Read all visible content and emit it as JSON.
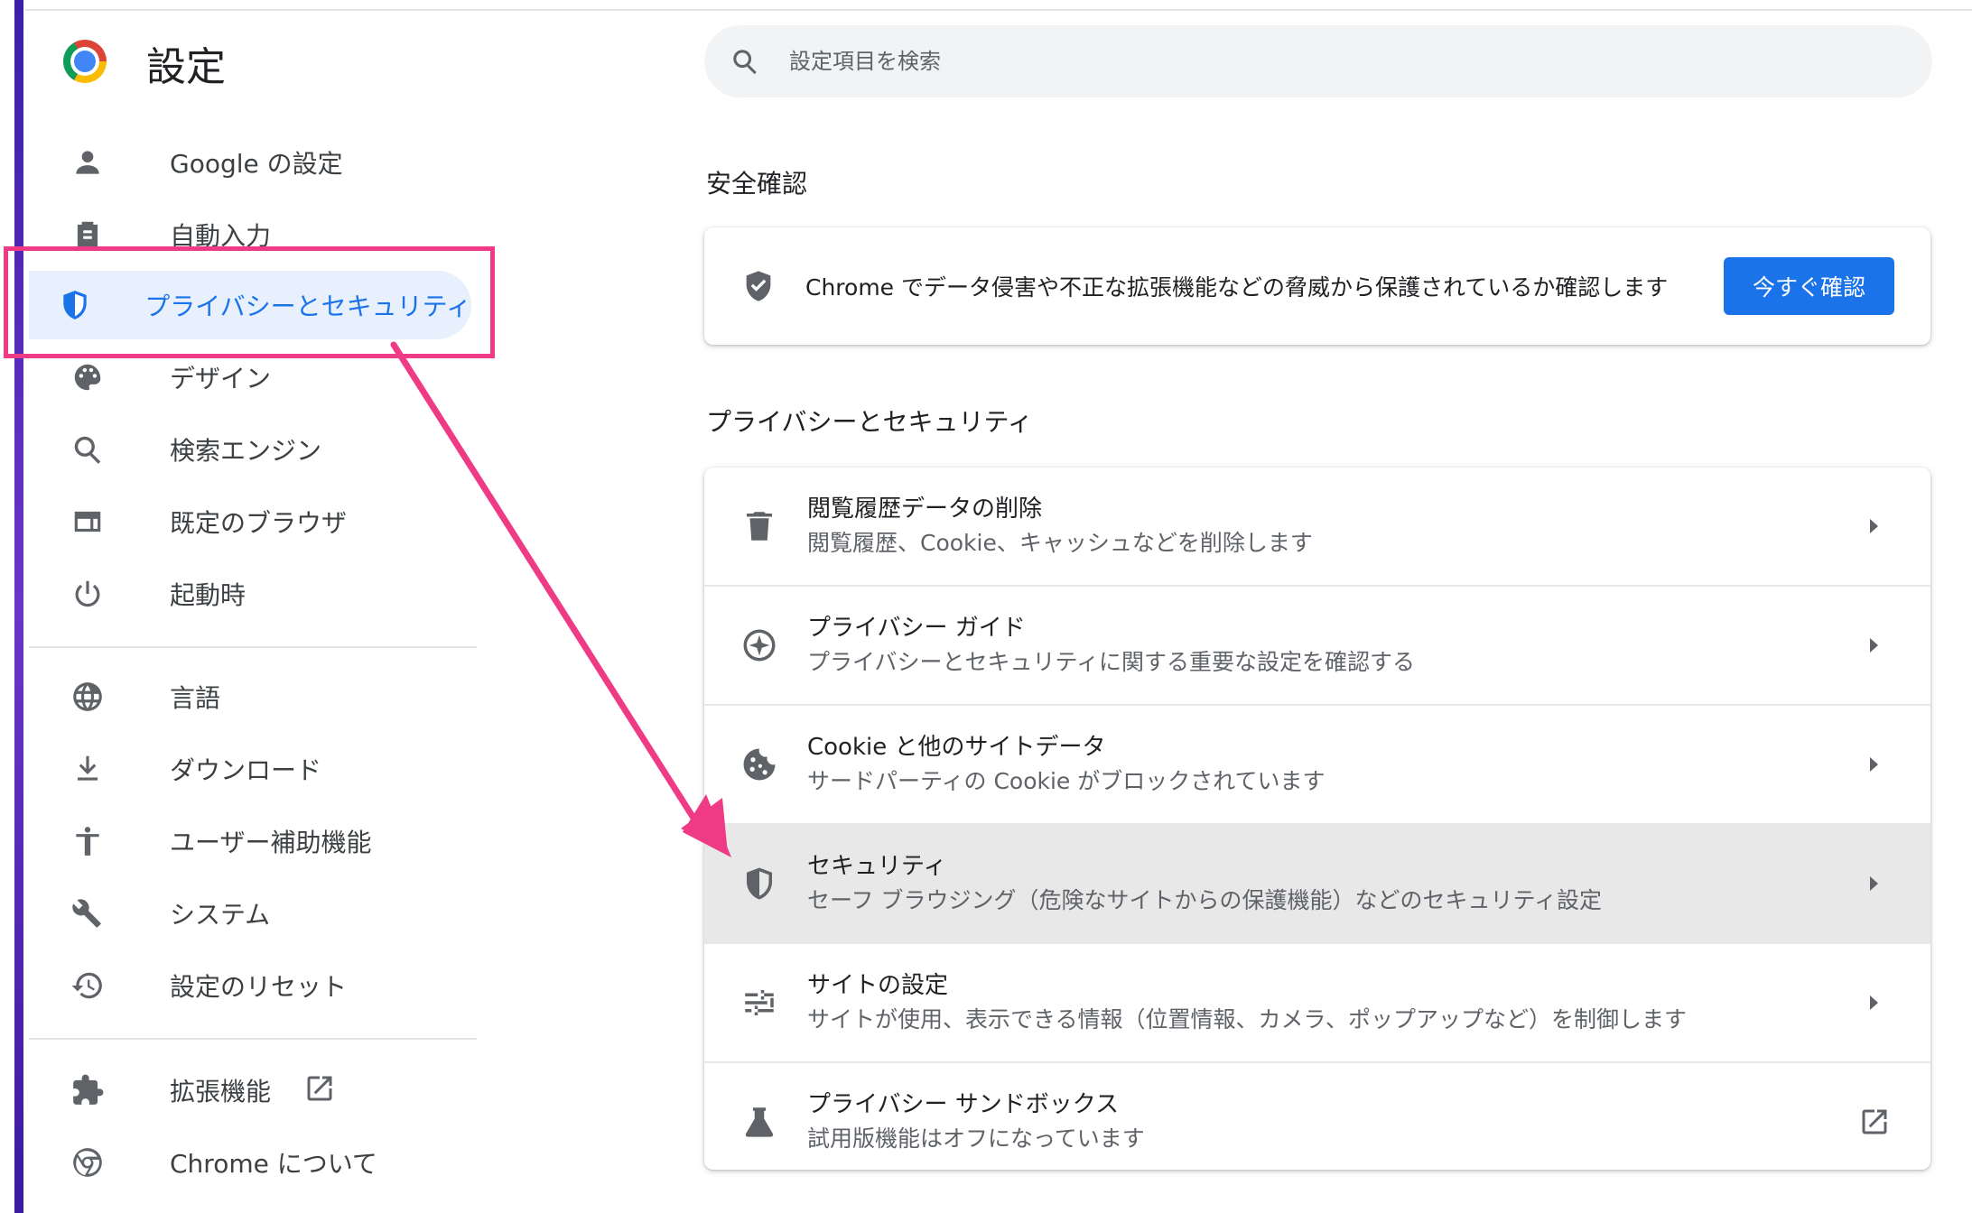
{
  "app": {
    "title": "設定",
    "logo": "chrome-logo"
  },
  "search": {
    "placeholder": "設定項目を検索",
    "icon": "search-icon"
  },
  "sidebar": {
    "items": [
      {
        "label": "Google の設定",
        "icon": "person-icon"
      },
      {
        "label": "自動入力",
        "icon": "clipboard-icon"
      },
      {
        "label": "プライバシーとセキュリティ",
        "icon": "shield-icon",
        "active": true
      },
      {
        "label": "デザイン",
        "icon": "palette-icon"
      },
      {
        "label": "検索エンジン",
        "icon": "search-icon"
      },
      {
        "label": "既定のブラウザ",
        "icon": "browser-window-icon"
      },
      {
        "label": "起動時",
        "icon": "power-icon"
      },
      {
        "label": "言語",
        "icon": "globe-icon"
      },
      {
        "label": "ダウンロード",
        "icon": "download-icon"
      },
      {
        "label": "ユーザー補助機能",
        "icon": "accessibility-icon"
      },
      {
        "label": "システム",
        "icon": "wrench-icon"
      },
      {
        "label": "設定のリセット",
        "icon": "history-icon"
      },
      {
        "label": "拡張機能",
        "icon": "puzzle-icon"
      },
      {
        "label": "Chrome について",
        "icon": "chrome-icon"
      }
    ]
  },
  "safety_check": {
    "heading": "安全確認",
    "text": "Chrome でデータ侵害や不正な拡張機能などの脅威から保護されているか確認します",
    "button": "今すぐ確認"
  },
  "privacy": {
    "heading": "プライバシーとセキュリティ",
    "rows": [
      {
        "title": "閲覧履歴データの削除",
        "subtitle": "閲覧履歴、Cookie、キャッシュなどを削除します",
        "icon": "trash-icon"
      },
      {
        "title": "プライバシー ガイド",
        "subtitle": "プライバシーとセキュリティに関する重要な設定を確認する",
        "icon": "compass-icon"
      },
      {
        "title": "Cookie と他のサイトデータ",
        "subtitle": "サードパーティの Cookie がブロックされています",
        "icon": "cookie-icon"
      },
      {
        "title": "セキュリティ",
        "subtitle": "セーフ ブラウジング（危険なサイトからの保護機能）などのセキュリティ設定",
        "icon": "shield-half-icon"
      },
      {
        "title": "サイトの設定",
        "subtitle": "サイトが使用、表示できる情報（位置情報、カメラ、ポップアップなど）を制御します",
        "icon": "tune-icon"
      },
      {
        "title": "プライバシー サンドボックス",
        "subtitle": "試用版機能はオフになっています",
        "icon": "flask-icon"
      }
    ]
  },
  "colors": {
    "accent": "#1a73e8",
    "annotation": "#ef3b86",
    "active_bg": "#e8f0fe"
  }
}
